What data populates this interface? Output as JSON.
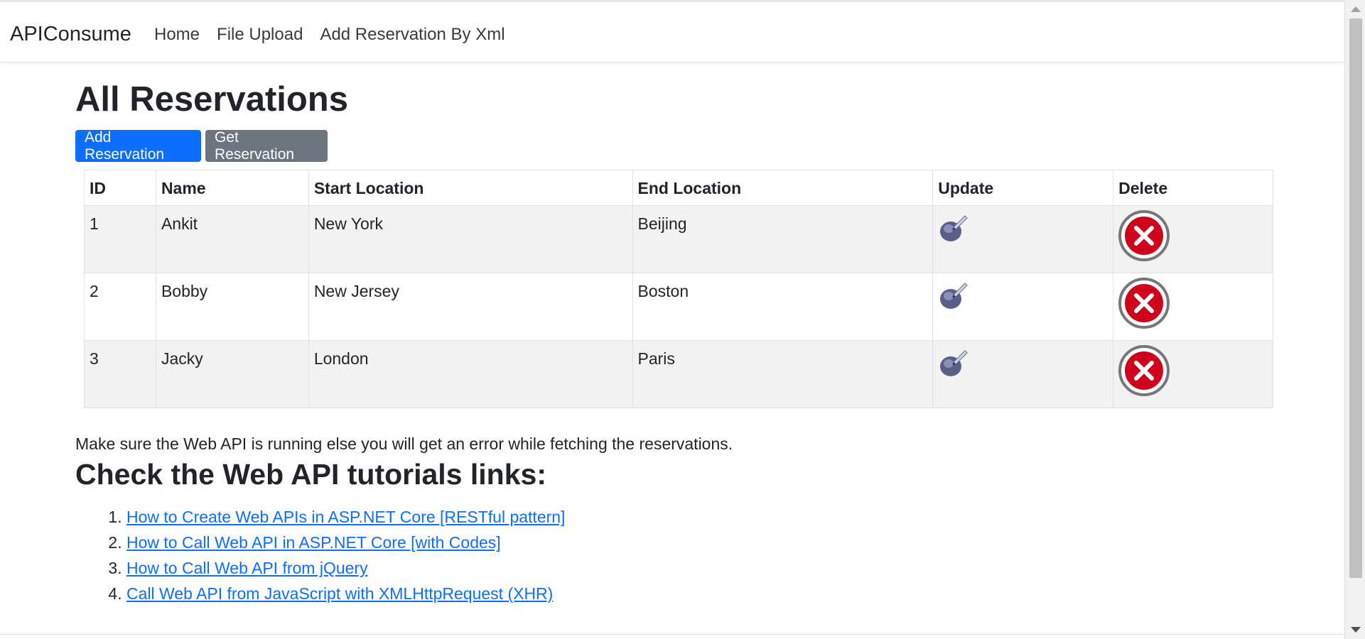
{
  "navbar": {
    "brand": "APIConsume",
    "links": [
      "Home",
      "File Upload",
      "Add Reservation By Xml"
    ]
  },
  "main": {
    "title": "All Reservations",
    "buttons": {
      "add": "Add Reservation",
      "get": "Get Reservation"
    },
    "table": {
      "headers": [
        "ID",
        "Name",
        "Start Location",
        "End Location",
        "Update",
        "Delete"
      ],
      "rows": [
        {
          "id": "1",
          "name": "Ankit",
          "start": "New York",
          "end": "Beijing"
        },
        {
          "id": "2",
          "name": "Bobby",
          "start": "New Jersey",
          "end": "Boston"
        },
        {
          "id": "3",
          "name": "Jacky",
          "start": "London",
          "end": "Paris"
        }
      ],
      "update_icon": "edit-pen-icon",
      "delete_icon": "delete-x-icon"
    },
    "note": "Make sure the Web API is running else you will get an error while fetching the reservations.",
    "links_title": "Check the Web API tutorials links:",
    "links": [
      "How to Create Web APIs in ASP.NET Core [RESTful pattern]",
      "How to Call Web API in ASP.NET Core [with Codes]",
      "How to Call Web API from jQuery",
      "Call Web API from JavaScript with XMLHttpRequest (XHR)"
    ]
  },
  "colors": {
    "primary": "#0d6efd",
    "secondary": "#6c757d",
    "stripe": "#f2f2f2",
    "delete_red": "#d0021b"
  }
}
